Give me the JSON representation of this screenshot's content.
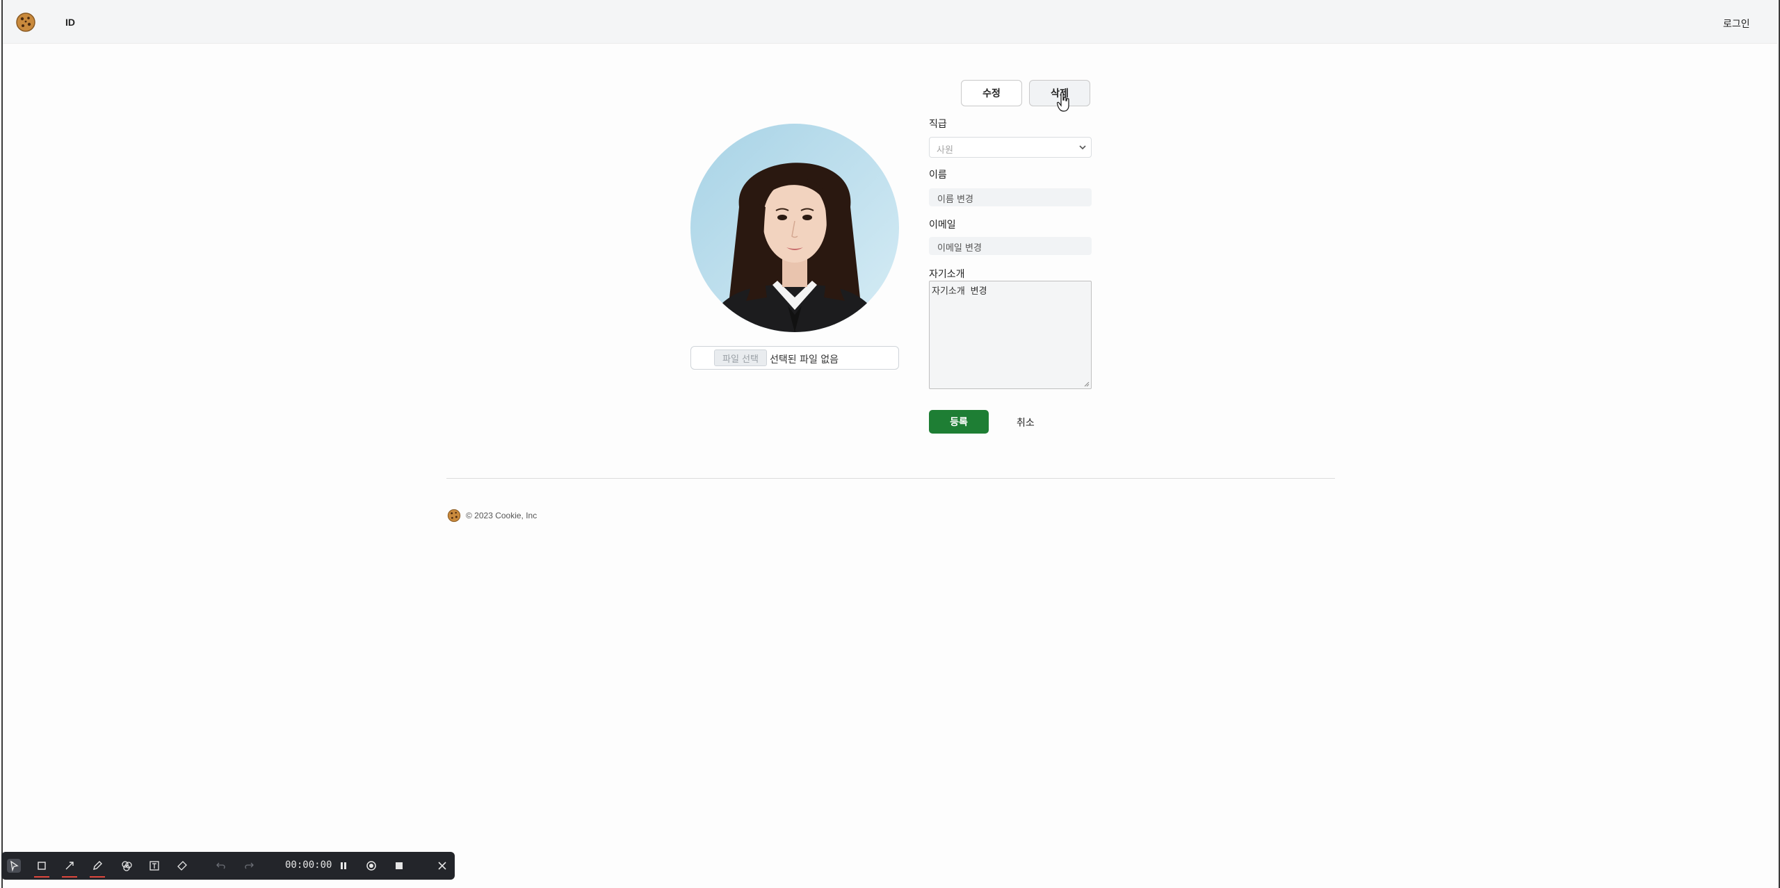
{
  "header": {
    "brand_label": "ID",
    "login_label": "로그인"
  },
  "actions": {
    "edit_label": "수정",
    "delete_label": "삭제"
  },
  "profile": {
    "file_button_label": "파일 선택",
    "file_status": "선택된 파일 없음"
  },
  "form": {
    "position_label": "직급",
    "position_value": "사원",
    "name_label": "이름",
    "name_placeholder": "이름 변경",
    "email_label": "이메일",
    "email_placeholder": "이메일 변경",
    "bio_label": "자기소개",
    "bio_placeholder": "자기소개 변경",
    "submit_label": "등록",
    "cancel_label": "취소"
  },
  "footer": {
    "copyright": "© 2023 Cookie, Inc"
  },
  "recorder": {
    "timer": "00:00:00"
  },
  "colors": {
    "submit_bg": "#1e7e34",
    "header_bg": "#f4f5f6",
    "recorder_bg": "#23252a",
    "recorder_accent": "#e0473d"
  },
  "icons": [
    "cookie-logo-icon",
    "hand-pointer-icon",
    "chevron-down-icon",
    "select-icon",
    "rectangle-icon",
    "arrow-icon",
    "pen-icon",
    "shapes-icon",
    "text-icon",
    "eraser-icon",
    "undo-icon",
    "redo-icon",
    "pause-icon",
    "record-icon",
    "stop-icon",
    "close-icon"
  ]
}
